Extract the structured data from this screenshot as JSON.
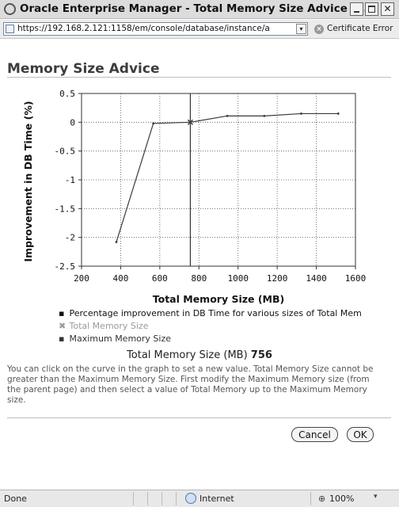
{
  "window": {
    "title": "Oracle Enterprise Manager - Total Memory Size Advice -...",
    "minimize_glyph": "_",
    "maximize_glyph": "□",
    "close_glyph": "✕"
  },
  "address_bar": {
    "url": "https://192.168.2.121:1158/em/console/database/instance/a",
    "dropdown_glyph": "▾",
    "certificate_label": "Certificate Error",
    "certificate_glyph": "×"
  },
  "page": {
    "heading": "Memory Size Advice"
  },
  "chart_data": {
    "type": "line",
    "ylabel": "Improvement in DB Time (%)",
    "xlabel": "Total Memory Size (MB)",
    "x_ticks": [
      "200",
      "400",
      "600",
      "800",
      "1000",
      "1200",
      "1400",
      "1600"
    ],
    "y_ticks": [
      "0.5",
      "0",
      "-0.5",
      "-1",
      "-1.5",
      "-2",
      "-2.5"
    ],
    "xlim": [
      200,
      1600
    ],
    "ylim": [
      -2.5,
      0.5
    ],
    "grid": true,
    "series": [
      {
        "name": "Percentage improvement in DB Time for various sizes of Total Mem",
        "x": [
          378,
          567,
          756,
          945,
          1134,
          1323,
          1512
        ],
        "y": [
          -2.08,
          -0.02,
          0,
          0.11,
          0.11,
          0.15,
          0.15
        ],
        "color": "#3a3a3a"
      }
    ],
    "current_marker": {
      "name": "Total Memory Size",
      "x": 756,
      "y": 0,
      "color": "#999999"
    },
    "maximum_line": {
      "name": "Maximum Memory Size",
      "x": 756,
      "color": "#333333"
    },
    "legend_position": "bottom"
  },
  "legend": [
    {
      "marker": "▪",
      "label": "Percentage improvement in DB Time for various sizes of Total Mem",
      "color": "#111111"
    },
    {
      "marker": "✖",
      "label": "Total Memory Size",
      "color": "#999999"
    },
    {
      "marker": "▪",
      "label": "Maximum Memory Size",
      "color": "#333333"
    }
  ],
  "selection": {
    "label": "Total Memory Size (MB)",
    "value": "756"
  },
  "help_text": "You can click on the curve in the graph to set a new value. Total Memory Size cannot be greater than the Maximum Memory Size. First modify the Maximum Memory size (from the parent page) and then select a value of Total Memory up to the Maximum Memory size.",
  "buttons": {
    "cancel": "Cancel",
    "ok": "OK"
  },
  "status_bar": {
    "status": "Done",
    "zone": "Internet",
    "zoom": "100%",
    "zoom_dropdown_glyph": "▾"
  }
}
